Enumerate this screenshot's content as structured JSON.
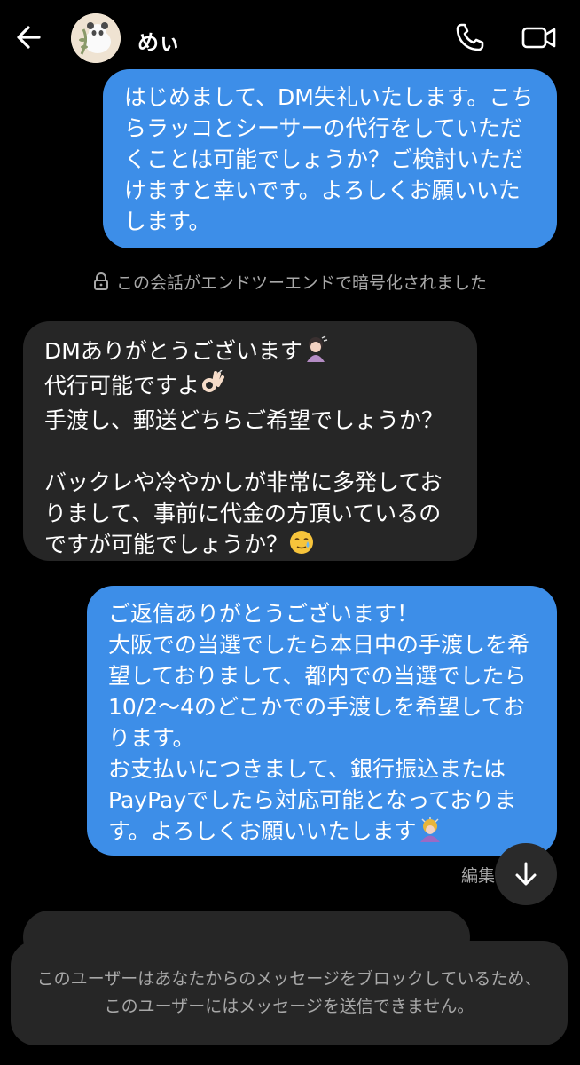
{
  "header": {
    "back_icon": "arrow-left-icon",
    "contact_name": "めぃ",
    "call_icon": "phone-icon",
    "video_icon": "video-camera-icon"
  },
  "messages": [
    {
      "direction": "outgoing",
      "text": "はじめまして、DM失礼いたします。こちらラッコとシーサーの代行をしていただくことは可能でしょうか？ご検討いただけますと幸いです。よろしくお願いいたします。"
    },
    {
      "direction": "incoming",
      "lines": [
        "DMありがとうございます",
        "代行可能ですよ",
        "手渡し、郵送どちらご希望でしょうか？",
        "",
        "バックレや冷やかしが非常に多発しておりまして、事前に代金の方頂いているのですが可能でしょうか？"
      ],
      "emojis": [
        "person-bowing-emoji",
        "ok-hand-emoji",
        "smiling-face-with-tear-emoji"
      ]
    },
    {
      "direction": "outgoing",
      "text": "ご返信ありがとうございます！\n大阪での当選でしたら本日中の手渡しを希望しておりまして、都内での当選でしたら10/2～4のどこかでの手渡しを希望しております。\nお支払いにつきまして、銀行振込またはPayPayでしたら対応可能となっております。よろしくお願いいたします",
      "emojis": [
        "person-bowing-emoji"
      ],
      "status": "編集"
    }
  ],
  "e2e_notice": "この会話がエンドツーエンドで暗号化されました",
  "blocked_notice": "このユーザーはあなたからのメッセージをブロックしているため、このユーザーにはメッセージを送信できません。",
  "colors": {
    "background": "#000000",
    "outgoing_bubble": "#3d8ee8",
    "incoming_bubble": "#262626",
    "muted_text": "#a8a8a8"
  }
}
